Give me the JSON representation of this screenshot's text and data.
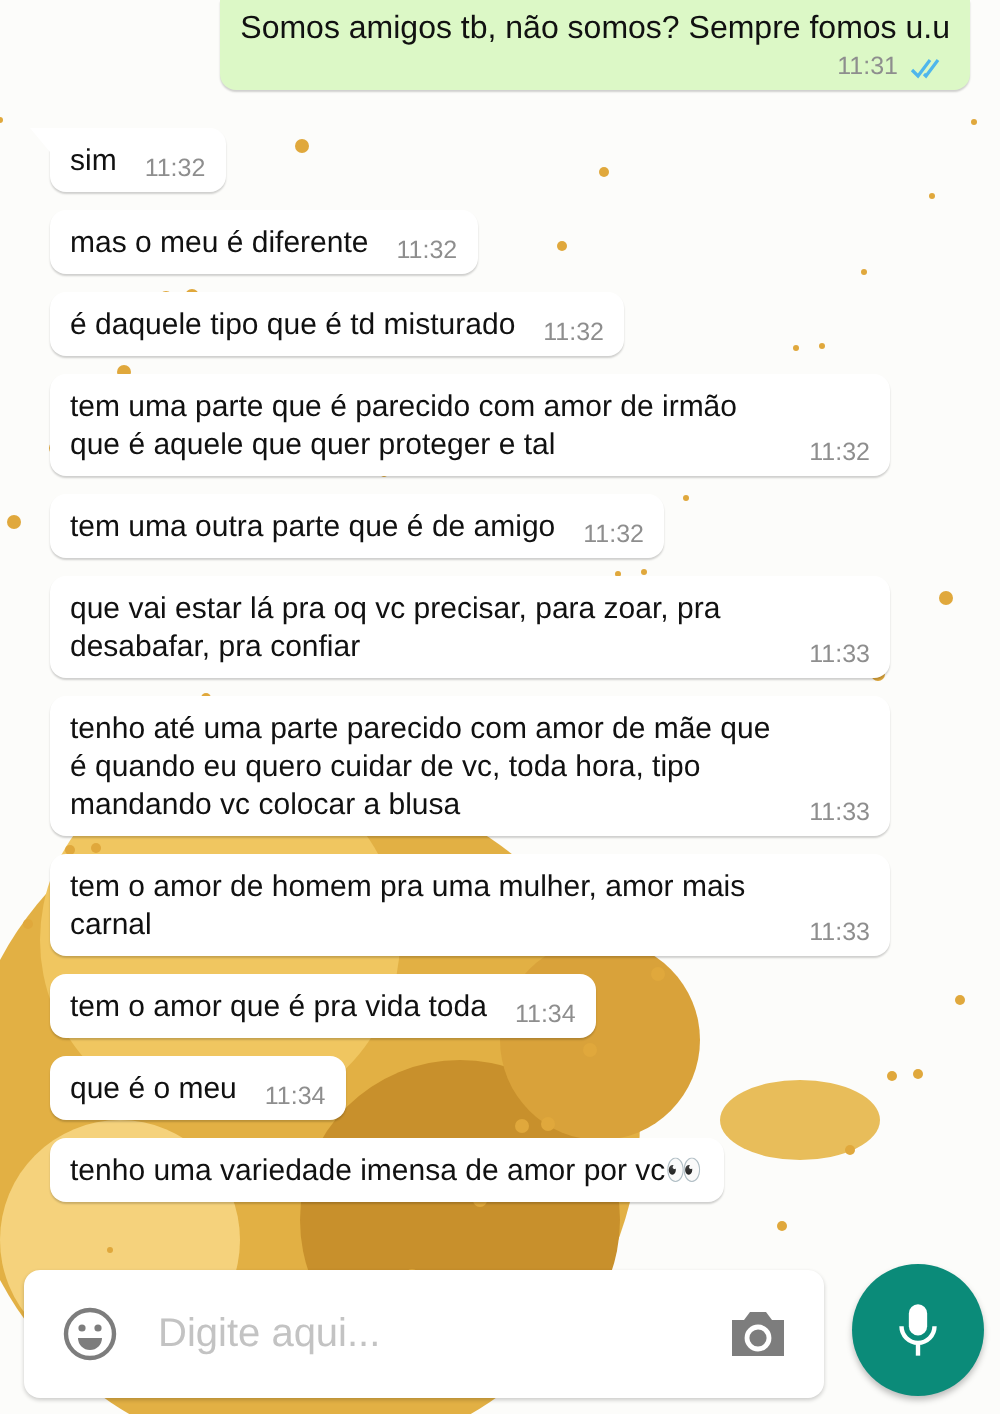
{
  "messages": [
    {
      "kind": "out",
      "text": "Somos amigos tb, não somos? Sempre fomos u.u",
      "time": "11:31",
      "read": true
    },
    {
      "kind": "in",
      "text": "sim",
      "time": "11:32"
    },
    {
      "kind": "in",
      "text": "mas o meu é diferente",
      "time": "11:32"
    },
    {
      "kind": "in",
      "text": "é daquele tipo que é td misturado",
      "time": "11:32"
    },
    {
      "kind": "in",
      "text": "tem uma parte que é parecido com amor de irmão que é aquele que quer proteger e tal",
      "time": "11:32"
    },
    {
      "kind": "in",
      "text": "tem uma outra parte que é de amigo",
      "time": "11:32"
    },
    {
      "kind": "in",
      "text": "que vai estar lá pra oq vc precisar, para zoar, pra desabafar, pra confiar",
      "time": "11:33"
    },
    {
      "kind": "in",
      "text": "tenho até uma parte parecido com amor de mãe que é quando eu quero cuidar de vc, toda hora, tipo mandando vc colocar a blusa",
      "time": "11:33"
    },
    {
      "kind": "in",
      "text": "tem o amor de homem pra uma mulher, amor mais carnal",
      "time": "11:33"
    },
    {
      "kind": "in",
      "text": "tem o amor que é pra vida toda",
      "time": "11:34"
    },
    {
      "kind": "in",
      "text": "que é o meu",
      "time": "11:34"
    },
    {
      "kind": "in",
      "text": "tenho uma variedade imensa de amor por vc👀"
    }
  ],
  "composer": {
    "placeholder": "Digite aqui..."
  }
}
